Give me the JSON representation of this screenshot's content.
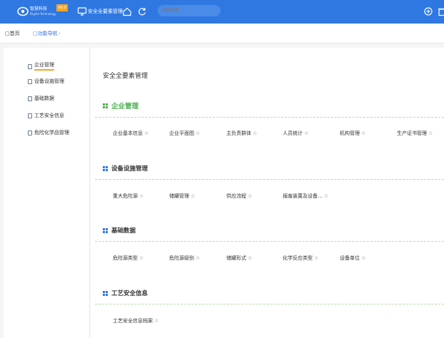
{
  "header": {
    "logo_text": "智慧科技",
    "logo_sub": "Digital Technology",
    "version_badge": "V6.0",
    "module_title": "安全全要素管理",
    "search_placeholder": "功能搜索",
    "colors": {
      "bar": "#2f78e2",
      "badge": "#f5a623"
    }
  },
  "breadcrumb": {
    "home": "首页",
    "current": "功能导航",
    "separator": "›"
  },
  "sidebar": {
    "items": [
      {
        "label": "企业管理"
      },
      {
        "label": "设备设施管理"
      },
      {
        "label": "基础数据"
      },
      {
        "label": "工艺安全信息"
      },
      {
        "label": "危险化学品管理"
      }
    ]
  },
  "main": {
    "title": "安全全要素管理",
    "sections": [
      {
        "title": "企业管理",
        "links": [
          "企业基本信息",
          "企业平面图",
          "主负责群体",
          "人员统计",
          "机构管理",
          "生产证书管理"
        ]
      },
      {
        "title": "设备设施管理",
        "links": [
          "重大危险源",
          "储罐管理",
          "供应流程",
          "报废装置及设备..."
        ]
      },
      {
        "title": "基础数据",
        "links": [
          "危险源类型",
          "危险源级别",
          "储罐形式",
          "化学反应类型",
          "设备单位"
        ]
      },
      {
        "title": "工艺安全信息",
        "links": [
          "工艺安全信息档案"
        ]
      }
    ],
    "star_glyph": "☆"
  }
}
